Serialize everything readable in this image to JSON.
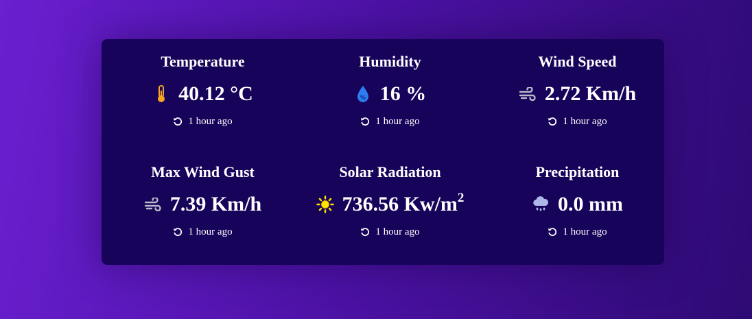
{
  "cards": [
    {
      "title": "Temperature",
      "value": "40.12 °C",
      "icon": "thermometer-icon",
      "icon_color": "#f5a623",
      "updated": "1 hour ago"
    },
    {
      "title": "Humidity",
      "value": "16 %",
      "icon": "water-drop-icon",
      "icon_color": "#2d7cf0",
      "updated": "1 hour ago"
    },
    {
      "title": "Wind Speed",
      "value": "2.72 Km/h",
      "icon": "wind-icon",
      "icon_color": "#b9b9c8",
      "updated": "1 hour ago"
    },
    {
      "title": "Max Wind Gust",
      "value": "7.39 Km/h",
      "icon": "wind-icon",
      "icon_color": "#b9b9c8",
      "updated": "1 hour ago"
    },
    {
      "title": "Solar Radiation",
      "value": "736.56 Kw/m",
      "value_sup": "2",
      "icon": "sun-icon",
      "icon_color": "#ffe600",
      "updated": "1 hour ago"
    },
    {
      "title": "Precipitation",
      "value": "0.0 mm",
      "icon": "cloud-rain-icon",
      "icon_color": "#aeb8e8",
      "updated": "1 hour ago"
    }
  ],
  "colors": {
    "background_start": "#6a1fd0",
    "background_end": "#2e0a74",
    "panel": "#17035a",
    "text": "#ffffff"
  }
}
